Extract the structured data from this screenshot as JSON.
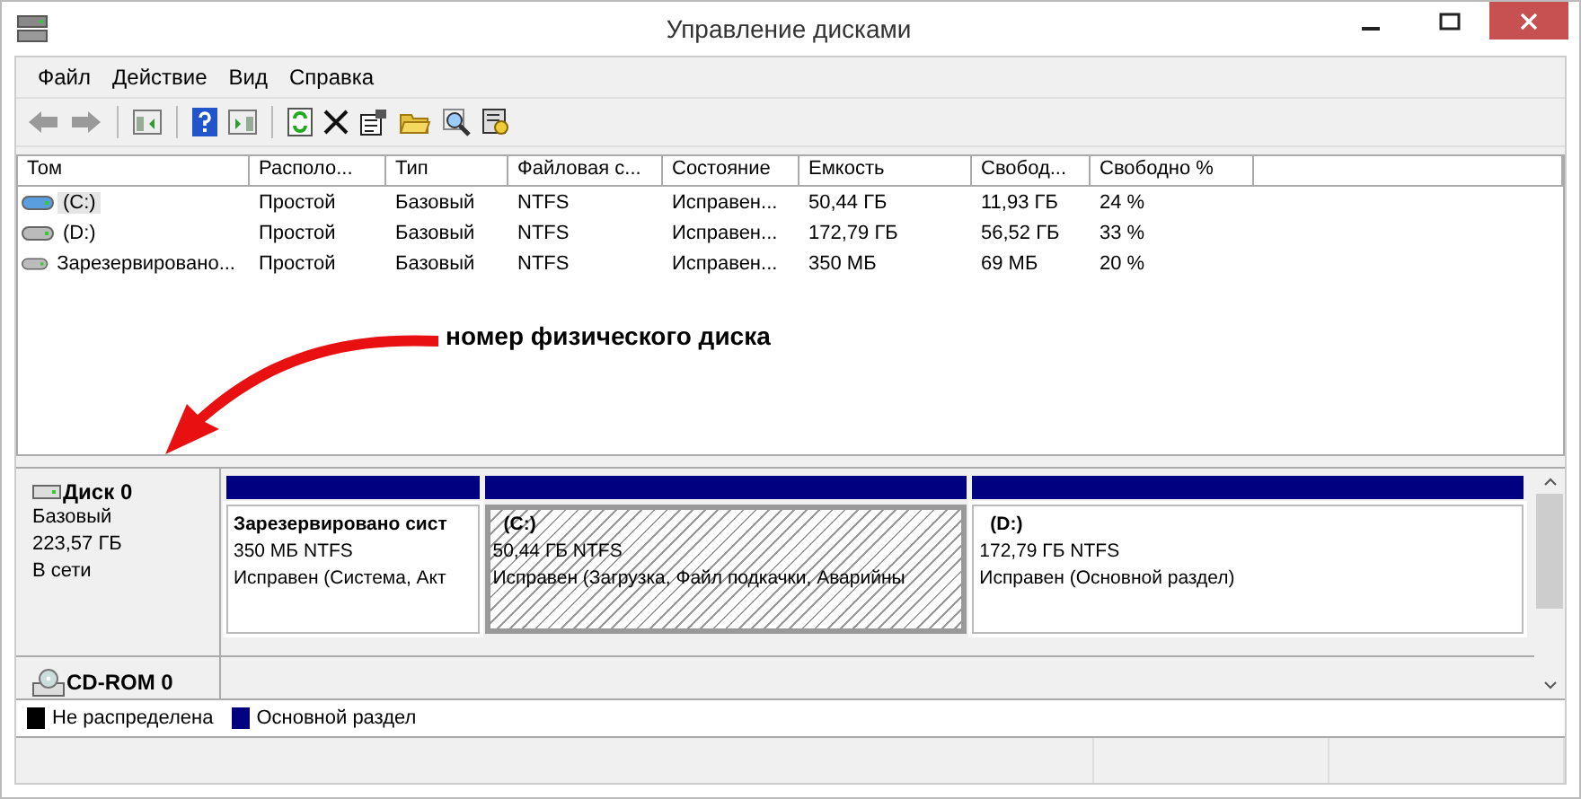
{
  "window": {
    "title": "Управление дисками"
  },
  "menu": [
    "Файл",
    "Действие",
    "Вид",
    "Справка"
  ],
  "table": {
    "columns": [
      "Том",
      "Располо...",
      "Тип",
      "Файловая с...",
      "Состояние",
      "Емкость",
      "Свобод...",
      "Свободно %"
    ],
    "rows": [
      {
        "selected": true,
        "cells": [
          "(C:)",
          "Простой",
          "Базовый",
          "NTFS",
          "Исправен...",
          "50,44 ГБ",
          "11,93 ГБ",
          "24 %"
        ]
      },
      {
        "selected": false,
        "cells": [
          "(D:)",
          "Простой",
          "Базовый",
          "NTFS",
          "Исправен...",
          "172,79 ГБ",
          "56,52 ГБ",
          "33 %"
        ]
      },
      {
        "selected": false,
        "cells": [
          "Зарезервировано...",
          "Простой",
          "Базовый",
          "NTFS",
          "Исправен...",
          "350 МБ",
          "69 МБ",
          "20 %"
        ]
      }
    ]
  },
  "annotation": "номер физического диска",
  "disks": [
    {
      "kind": "disk",
      "name": "Диск 0",
      "details": [
        "Базовый",
        "223,57 ГБ",
        "В сети"
      ],
      "partitions": [
        {
          "name": "Зарезервировано сист",
          "size": "350 МБ NTFS",
          "status": "Исправен (Система, Акт",
          "selected": false
        },
        {
          "name": "(C:)",
          "size": "50,44 ГБ NTFS",
          "status": "Исправен (Загрузка, Файл подкачки, Аварийны",
          "selected": true
        },
        {
          "name": "(D:)",
          "size": "172,79 ГБ NTFS",
          "status": "Исправен (Основной раздел)",
          "selected": false
        }
      ]
    },
    {
      "kind": "cdrom",
      "name": "CD-ROM 0"
    }
  ],
  "legend": [
    {
      "label": "Не распределена",
      "color": "#000000"
    },
    {
      "label": "Основной раздел",
      "color": "#000080"
    }
  ]
}
